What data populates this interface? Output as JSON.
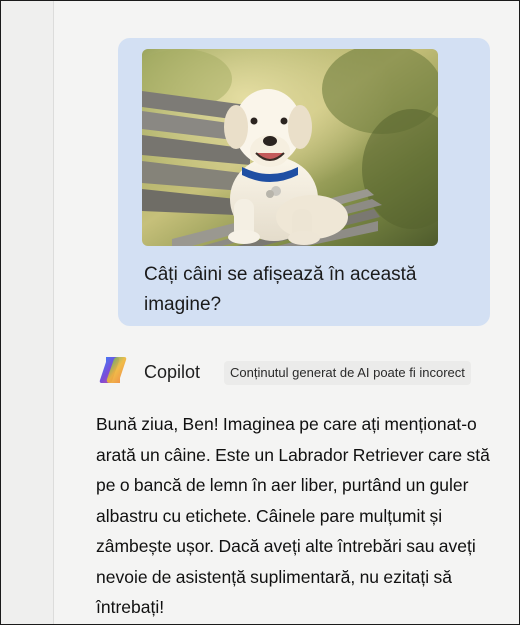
{
  "user_message": {
    "image_subject": "dog-on-bench-photo",
    "text": "Câți câini se afișează în această imagine?"
  },
  "assistant": {
    "name": "Copilot",
    "disclaimer": "Conținutul generat de AI poate fi incorect",
    "reply": "Bună ziua, Ben! Imaginea pe care ați menționat-o arată un câine. Este un Labrador Retriever care stă pe o bancă de lemn în aer liber, purtând un guler albastru cu etichete. Câinele pare mulțumit și zâmbește ușor. Dacă aveți alte întrebări sau aveți nevoie de asistență suplimentară, nu ezitați să întrebați!"
  },
  "colors": {
    "user_bubble": "#d3e0f3",
    "background": "#f4f4f3",
    "dog_collar": "#1f4fa3"
  }
}
